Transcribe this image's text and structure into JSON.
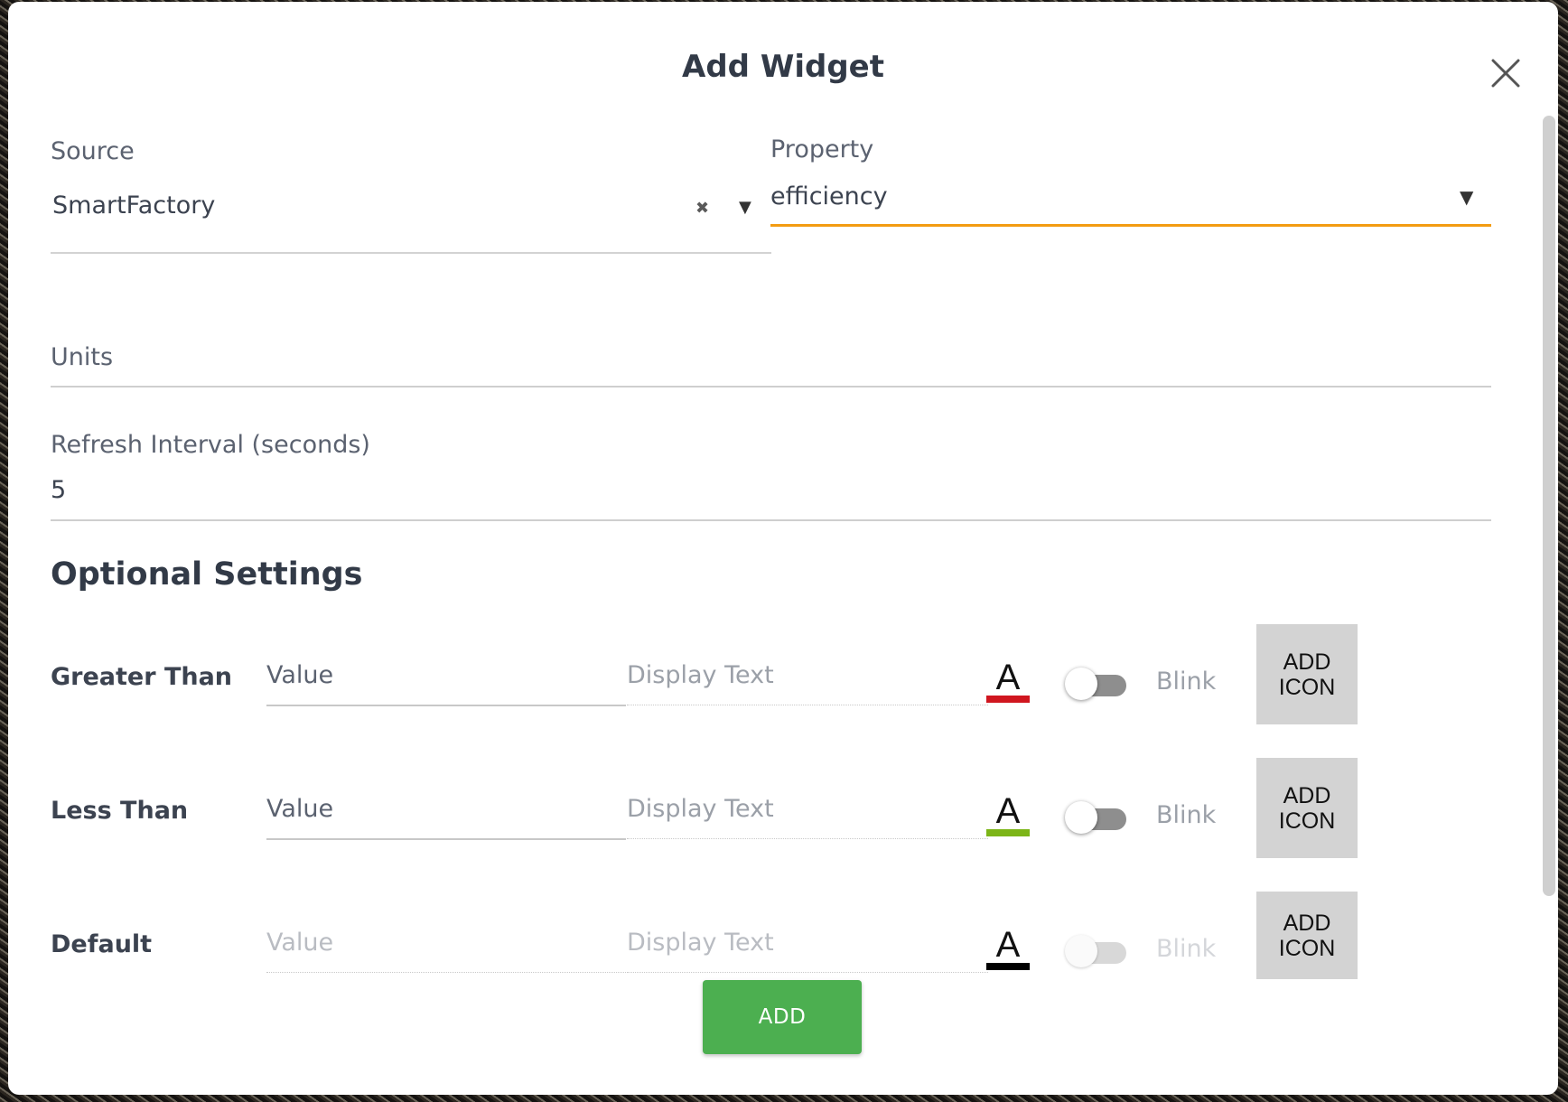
{
  "dialog": {
    "title": "Add Widget",
    "close_icon": "close-icon"
  },
  "source": {
    "label": "Source",
    "value": "SmartFactory",
    "clear_glyph": "✖",
    "dropdown_glyph": "▼"
  },
  "property": {
    "label": "Property",
    "value": "efficiency",
    "dropdown_glyph": "▼",
    "accent_color": "#f39c12"
  },
  "units": {
    "label": "Units",
    "value": ""
  },
  "refresh": {
    "label": "Refresh Interval (seconds)",
    "value": "5"
  },
  "optional": {
    "title": "Optional Settings",
    "rows": [
      {
        "label": "Greater Than",
        "value_placeholder": "Value",
        "display_placeholder": "Display Text",
        "color_glyph": "A",
        "color": "#d0161f",
        "blink_label": "Blink",
        "blink_on": false,
        "add_icon_label": "ADD\nICON"
      },
      {
        "label": "Less Than",
        "value_placeholder": "Value",
        "display_placeholder": "Display Text",
        "color_glyph": "A",
        "color": "#7cb518",
        "blink_label": "Blink",
        "blink_on": false,
        "add_icon_label": "ADD\nICON"
      },
      {
        "label": "Default",
        "value_placeholder": "Value",
        "display_placeholder": "Display Text",
        "color_glyph": "A",
        "color": "#000000",
        "blink_label": "Blink",
        "blink_on": false,
        "add_icon_label": "ADD\nICON"
      }
    ]
  },
  "actions": {
    "add_label": "ADD",
    "add_color": "#4caf50"
  }
}
